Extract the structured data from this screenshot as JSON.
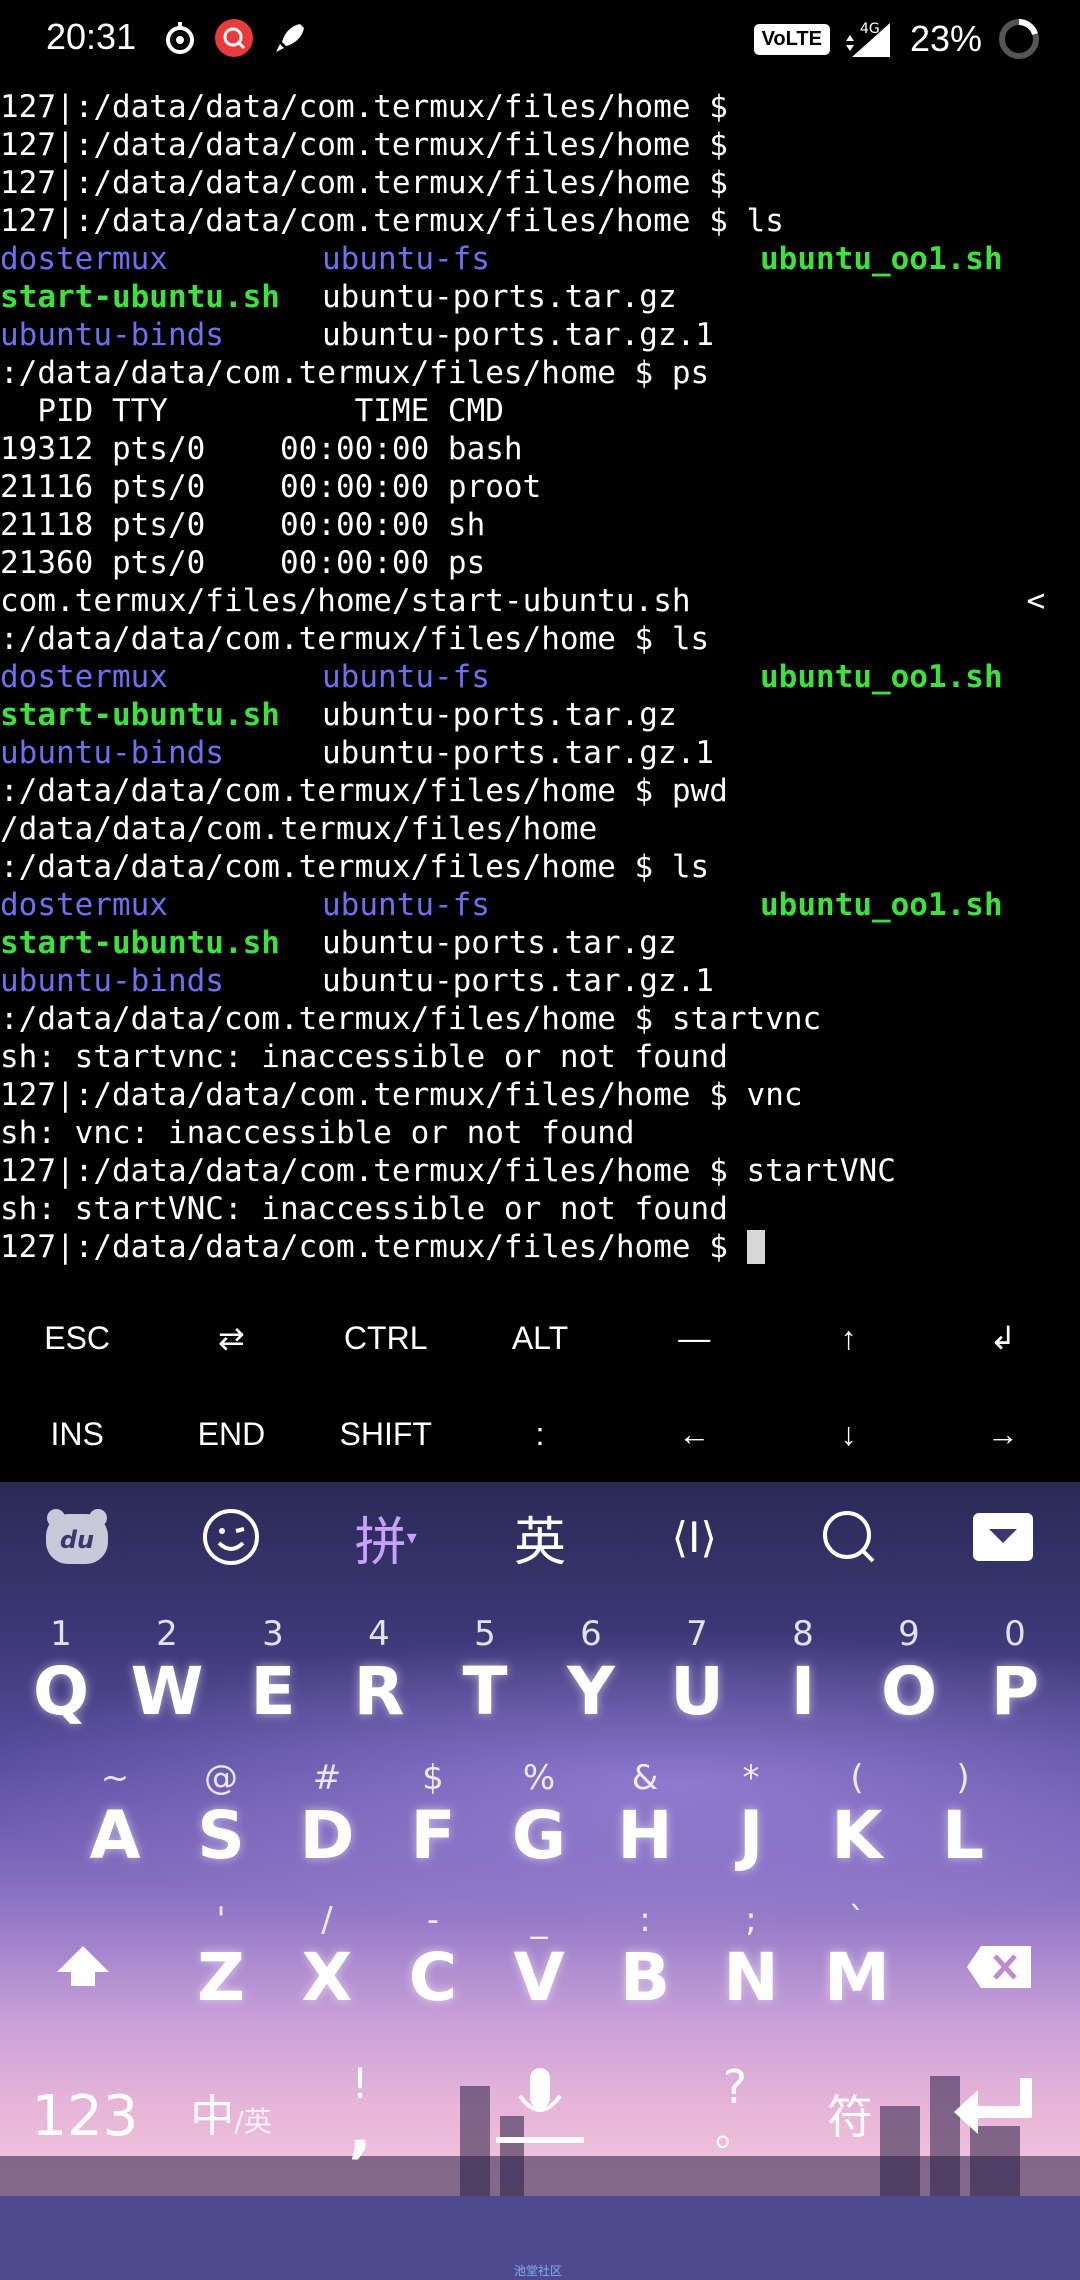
{
  "status_bar": {
    "time": "20:31",
    "network_badge": "VoLTE",
    "network_type": "4G",
    "battery": "23%"
  },
  "terminal": {
    "lines": [
      {
        "type": "text",
        "text": "127|:/data/data/com.termux/files/home $"
      },
      {
        "type": "text",
        "text": "127|:/data/data/com.termux/files/home $"
      },
      {
        "type": "text",
        "text": "127|:/data/data/com.termux/files/home $"
      },
      {
        "type": "text",
        "text": "127|:/data/data/com.termux/files/home $ ls"
      },
      {
        "type": "cols",
        "cells": [
          {
            "t": "dostermux",
            "c": "dir"
          },
          {
            "t": "ubuntu-fs",
            "c": "dir"
          },
          {
            "t": "ubuntu_oo1.sh",
            "c": "exe"
          }
        ]
      },
      {
        "type": "cols",
        "cells": [
          {
            "t": "start-ubuntu.sh",
            "c": "exe"
          },
          {
            "t": "ubuntu-ports.tar.gz",
            "c": ""
          },
          {
            "t": "",
            "c": ""
          }
        ]
      },
      {
        "type": "cols",
        "cells": [
          {
            "t": "ubuntu-binds",
            "c": "dir"
          },
          {
            "t": "ubuntu-ports.tar.gz.1",
            "c": ""
          },
          {
            "t": "",
            "c": ""
          }
        ]
      },
      {
        "type": "text",
        "text": ":/data/data/com.termux/files/home $ ps"
      },
      {
        "type": "text",
        "text": "  PID TTY          TIME CMD"
      },
      {
        "type": "text",
        "text": "19312 pts/0    00:00:00 bash"
      },
      {
        "type": "text",
        "text": "21116 pts/0    00:00:00 proot"
      },
      {
        "type": "text",
        "text": "21118 pts/0    00:00:00 sh"
      },
      {
        "type": "text",
        "text": "21360 pts/0    00:00:00 ps"
      },
      {
        "type": "text",
        "text": "com.termux/files/home/start-ubuntu.sh                  <"
      },
      {
        "type": "text",
        "text": ":/data/data/com.termux/files/home $ ls"
      },
      {
        "type": "cols",
        "cells": [
          {
            "t": "dostermux",
            "c": "dir"
          },
          {
            "t": "ubuntu-fs",
            "c": "dir"
          },
          {
            "t": "ubuntu_oo1.sh",
            "c": "exe"
          }
        ]
      },
      {
        "type": "cols",
        "cells": [
          {
            "t": "start-ubuntu.sh",
            "c": "exe"
          },
          {
            "t": "ubuntu-ports.tar.gz",
            "c": ""
          },
          {
            "t": "",
            "c": ""
          }
        ]
      },
      {
        "type": "cols",
        "cells": [
          {
            "t": "ubuntu-binds",
            "c": "dir"
          },
          {
            "t": "ubuntu-ports.tar.gz.1",
            "c": ""
          },
          {
            "t": "",
            "c": ""
          }
        ]
      },
      {
        "type": "text",
        "text": ":/data/data/com.termux/files/home $ pwd"
      },
      {
        "type": "text",
        "text": "/data/data/com.termux/files/home"
      },
      {
        "type": "text",
        "text": ":/data/data/com.termux/files/home $ ls"
      },
      {
        "type": "cols",
        "cells": [
          {
            "t": "dostermux",
            "c": "dir"
          },
          {
            "t": "ubuntu-fs",
            "c": "dir"
          },
          {
            "t": "ubuntu_oo1.sh",
            "c": "exe"
          }
        ]
      },
      {
        "type": "cols",
        "cells": [
          {
            "t": "start-ubuntu.sh",
            "c": "exe"
          },
          {
            "t": "ubuntu-ports.tar.gz",
            "c": ""
          },
          {
            "t": "",
            "c": ""
          }
        ]
      },
      {
        "type": "cols",
        "cells": [
          {
            "t": "ubuntu-binds",
            "c": "dir"
          },
          {
            "t": "ubuntu-ports.tar.gz.1",
            "c": ""
          },
          {
            "t": "",
            "c": ""
          }
        ]
      },
      {
        "type": "text",
        "text": ":/data/data/com.termux/files/home $ startvnc"
      },
      {
        "type": "text",
        "text": "sh: startvnc: inaccessible or not found"
      },
      {
        "type": "text",
        "text": "127|:/data/data/com.termux/files/home $ vnc"
      },
      {
        "type": "text",
        "text": "sh: vnc: inaccessible or not found"
      },
      {
        "type": "text",
        "text": "127|:/data/data/com.termux/files/home $ startVNC"
      },
      {
        "type": "text",
        "text": "sh: startVNC: inaccessible or not found"
      },
      {
        "type": "prompt",
        "text": "127|:/data/data/com.termux/files/home $ "
      }
    ],
    "colors": {
      "directory": "#6e70f0",
      "executable": "#3ee03e",
      "cursor": "#d8d8d8"
    }
  },
  "extra_keys": {
    "row1": [
      "ESC",
      "⇄",
      "CTRL",
      "ALT",
      "—",
      "↑",
      "↲"
    ],
    "row2": [
      "INS",
      "END",
      "SHIFT",
      ":",
      "←",
      "↓",
      "→"
    ]
  },
  "keyboard": {
    "toolbar": {
      "logo_label": "du",
      "emoji_icon": "emoji-icon",
      "pinyin_label": "拼",
      "english_label": "英",
      "cursor_label": "⟨I⟩",
      "search_icon": "search-icon",
      "hide_icon": "hide-keyboard-icon"
    },
    "row1": [
      {
        "hint": "1",
        "key": "Q"
      },
      {
        "hint": "2",
        "key": "W"
      },
      {
        "hint": "3",
        "key": "E"
      },
      {
        "hint": "4",
        "key": "R"
      },
      {
        "hint": "5",
        "key": "T"
      },
      {
        "hint": "6",
        "key": "Y"
      },
      {
        "hint": "7",
        "key": "U"
      },
      {
        "hint": "8",
        "key": "I"
      },
      {
        "hint": "9",
        "key": "O"
      },
      {
        "hint": "0",
        "key": "P"
      }
    ],
    "row2": [
      {
        "hint": "~",
        "key": "A"
      },
      {
        "hint": "@",
        "key": "S"
      },
      {
        "hint": "#",
        "key": "D"
      },
      {
        "hint": "$",
        "key": "F"
      },
      {
        "hint": "%",
        "key": "G"
      },
      {
        "hint": "&",
        "key": "H"
      },
      {
        "hint": "*",
        "key": "J"
      },
      {
        "hint": "(",
        "key": "K"
      },
      {
        "hint": ")",
        "key": "L"
      }
    ],
    "row3": [
      {
        "hint": "'",
        "key": "Z"
      },
      {
        "hint": "/",
        "key": "X"
      },
      {
        "hint": "-",
        "key": "C"
      },
      {
        "hint": "_",
        "key": "V"
      },
      {
        "hint": ":",
        "key": "B"
      },
      {
        "hint": ";",
        "key": "N"
      },
      {
        "hint": "`",
        "key": "M"
      }
    ],
    "bottom": {
      "numbers": "123",
      "lang": "中",
      "lang_sub": "/英",
      "punct_hint": "!",
      "punct": ",",
      "question_hint": "?",
      "question": "。",
      "symbols": "符"
    },
    "colors": {
      "accent_pinyin": "#c9a0ff",
      "nav_bar": "#4f4a8e"
    }
  },
  "nav_bar": {
    "tag": "池堂社区"
  }
}
